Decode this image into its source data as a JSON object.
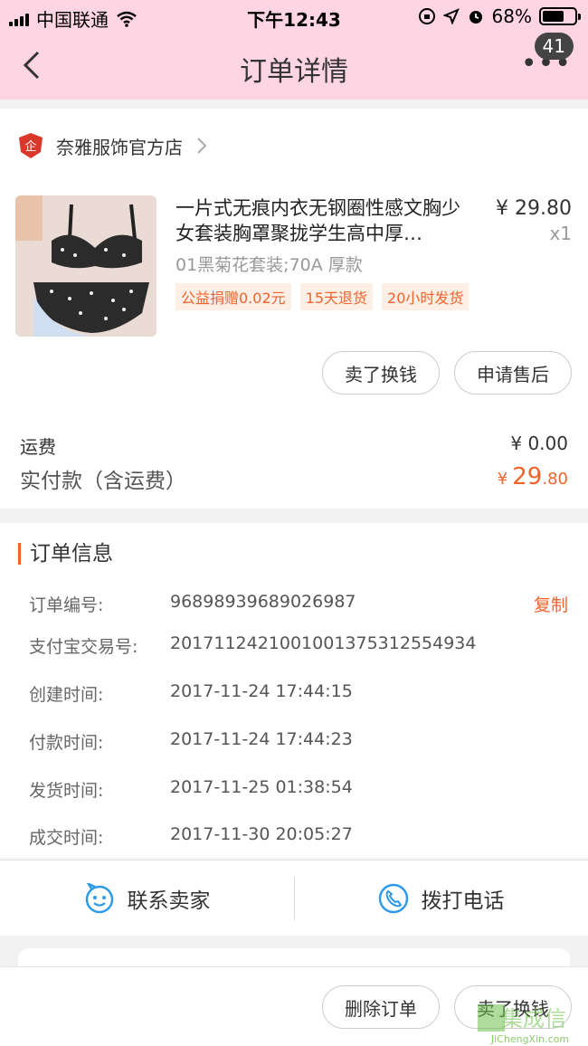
{
  "status_bar": {
    "carrier": "中国联通",
    "time": "下午12:43",
    "battery": "68%",
    "battery_level": 0.68
  },
  "nav": {
    "title": "订单详情",
    "badge": "41",
    "more": "•••"
  },
  "shop": {
    "logo_text": "企",
    "name": "奈雅服饰官方店"
  },
  "product": {
    "title": "一片式无痕内衣无钢圈性感文胸少女套装胸罩聚拢学生高中厚…",
    "price": "¥ 29.80",
    "qty": "x1",
    "spec": "01黑菊花套装;70A 厚款",
    "tags": [
      "公益捐赠0.02元",
      "15天退货",
      "20小时发货"
    ]
  },
  "actions": {
    "sell": "卖了换钱",
    "after_sale": "申请售后"
  },
  "fees": {
    "shipping_label": "运费",
    "shipping_value": "¥ 0.00",
    "total_label": "实付款（含运费）",
    "total_currency": "¥",
    "total_int": "29",
    "total_dec": ".80"
  },
  "order_info": {
    "title": "订单信息",
    "copy_label": "复制",
    "rows": [
      {
        "key": "订单编号:",
        "value": "96898939689026987"
      },
      {
        "key": "支付宝交易号:",
        "value": "2017112421001001375312554934"
      },
      {
        "key": "创建时间:",
        "value": "2017-11-24 17:44:15"
      },
      {
        "key": "付款时间:",
        "value": "2017-11-24 17:44:23"
      },
      {
        "key": "发货时间:",
        "value": "2017-11-25 01:38:54"
      },
      {
        "key": "成交时间:",
        "value": "2017-11-30 20:05:27"
      }
    ]
  },
  "contact": {
    "seller": "联系卖家",
    "phone": "拨打电话"
  },
  "bottom": {
    "delete": "删除订单",
    "sell": "卖了换钱"
  },
  "watermark": {
    "text": "集成信",
    "url": "JiChengXin.com"
  },
  "colors": {
    "header_pink": "#ffd5e3",
    "accent_orange": "#f0642b",
    "icon_blue": "#2f9be6",
    "shop_red": "#d9382b"
  }
}
